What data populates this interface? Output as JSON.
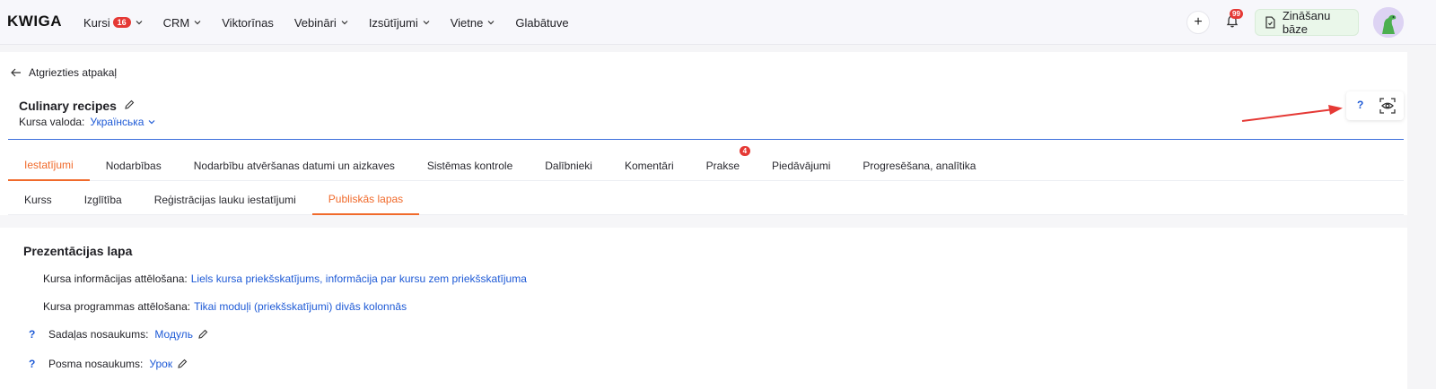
{
  "app": {
    "logo": "KWIGA"
  },
  "nav": {
    "items": [
      {
        "label": "Kursi",
        "badge": "16",
        "has_dropdown": true
      },
      {
        "label": "CRM",
        "badge": null,
        "has_dropdown": true
      },
      {
        "label": "Viktorīnas",
        "badge": null,
        "has_dropdown": false
      },
      {
        "label": "Vebināri",
        "badge": null,
        "has_dropdown": true
      },
      {
        "label": "Izsūtījumi",
        "badge": null,
        "has_dropdown": true
      },
      {
        "label": "Vietne",
        "badge": null,
        "has_dropdown": true
      },
      {
        "label": "Glabātuve",
        "badge": null,
        "has_dropdown": false
      }
    ],
    "plus_label": "+",
    "notifications_badge": "99",
    "knowledge_base_label": "Zināšanu bāze"
  },
  "page": {
    "back_label": "Atgriezties atpakaļ",
    "course_title": "Culinary recipes",
    "language_label": "Kursa valoda:",
    "language_value": "Українська",
    "help_label": "?"
  },
  "tabs": [
    {
      "label": "Iestatījumi",
      "active": true,
      "badge": null
    },
    {
      "label": "Nodarbības",
      "active": false,
      "badge": null
    },
    {
      "label": "Nodarbību atvēršanas datumi un aizkaves",
      "active": false,
      "badge": null
    },
    {
      "label": "Sistēmas kontrole",
      "active": false,
      "badge": null
    },
    {
      "label": "Dalībnieki",
      "active": false,
      "badge": null
    },
    {
      "label": "Komentāri",
      "active": false,
      "badge": null
    },
    {
      "label": "Prakse",
      "active": false,
      "badge": "4"
    },
    {
      "label": "Piedāvājumi",
      "active": false,
      "badge": null
    },
    {
      "label": "Progresēšana, analītika",
      "active": false,
      "badge": null
    }
  ],
  "subtabs": [
    {
      "label": "Kurss",
      "active": false
    },
    {
      "label": "Izglītība",
      "active": false
    },
    {
      "label": "Reģistrācijas lauku iestatījumi",
      "active": false
    },
    {
      "label": "Publiskās lapas",
      "active": true
    }
  ],
  "content": {
    "section_title": "Prezentācijas lapa",
    "rows": [
      {
        "label": "Kursa informācijas attēlošana:",
        "value": "Liels kursa priekšskatījums, informācija par kursu zem priekšskatījuma",
        "help": false,
        "editable": false
      },
      {
        "label": "Kursa programmas attēlošana:",
        "value": "Tikai moduļi (priekšskatījumi) divās kolonnās",
        "help": false,
        "editable": false
      },
      {
        "label": "Sadaļas nosaukums:",
        "value": "Модуль",
        "help": true,
        "editable": true
      },
      {
        "label": "Posma nosaukums:",
        "value": "Урок",
        "help": true,
        "editable": true
      }
    ],
    "help_mark": "?"
  },
  "colors": {
    "accent": "#f06a2b",
    "link": "#1e5ad6",
    "badge": "#e53935",
    "divider": "#3d6fdc"
  }
}
